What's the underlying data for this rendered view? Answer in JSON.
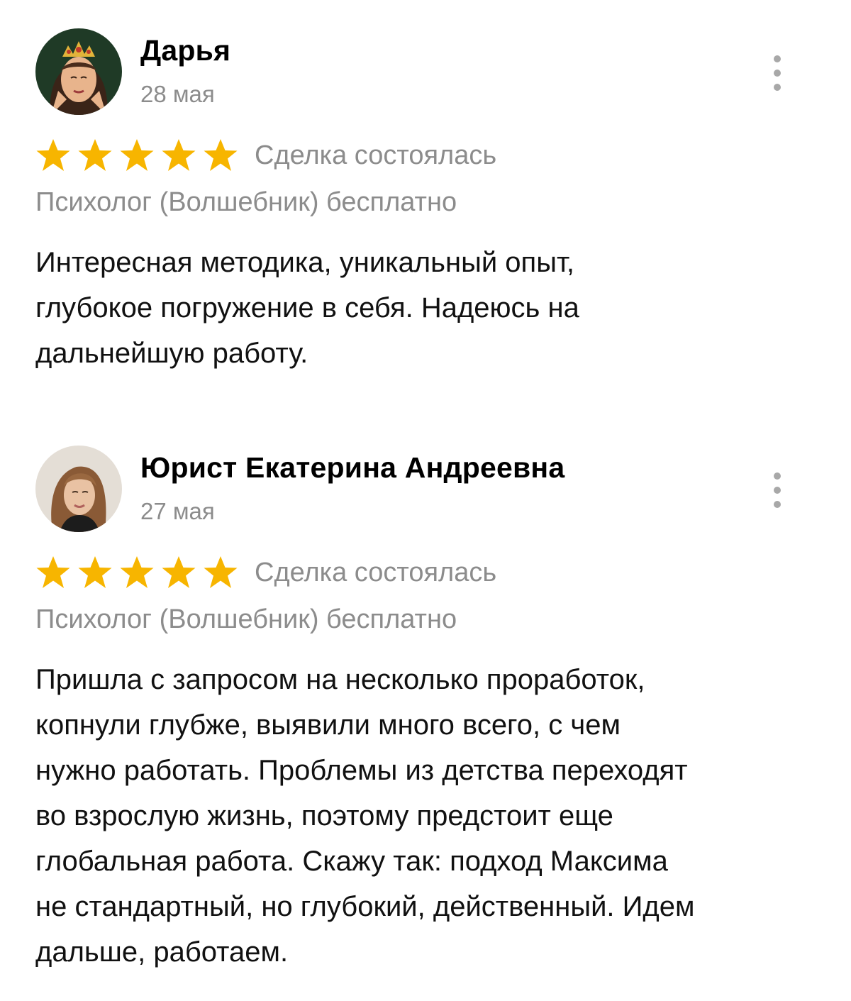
{
  "colors": {
    "star": "#f7b500",
    "muted_text": "#8c8c8c",
    "body_text": "#111111"
  },
  "reviews": [
    {
      "author": "Дарья",
      "date": "28 мая",
      "avatar_icon": "avatar-crown-illustration",
      "menu_icon": "more-vertical-icon",
      "rating": 5,
      "rating_max": 5,
      "status": "Сделка состоялась",
      "service": "Психолог (Волшебник) бесплатно",
      "text_lines": [
        "Интересная методика, уникальный опыт,",
        "глубокое погружение в себя. Надеюсь на",
        "дальнейшую работу."
      ]
    },
    {
      "author": "Юрист Екатерина Андреевна",
      "date": "27 мая",
      "avatar_icon": "avatar-photo",
      "menu_icon": "more-vertical-icon",
      "rating": 5,
      "rating_max": 5,
      "status": "Сделка состоялась",
      "service": "Психолог (Волшебник) бесплатно",
      "text_lines": [
        "Пришла с запросом на несколько проработок,",
        "копнули глубже, выявили много всего, с чем",
        "нужно работать. Проблемы из детства переходят",
        "во взрослую жизнь, поэтому предстоит еще",
        "глобальная работа. Скажу так: подход Максима",
        "не стандартный, но глубокий, действенный. Идем",
        "дальше, работаем."
      ]
    }
  ]
}
